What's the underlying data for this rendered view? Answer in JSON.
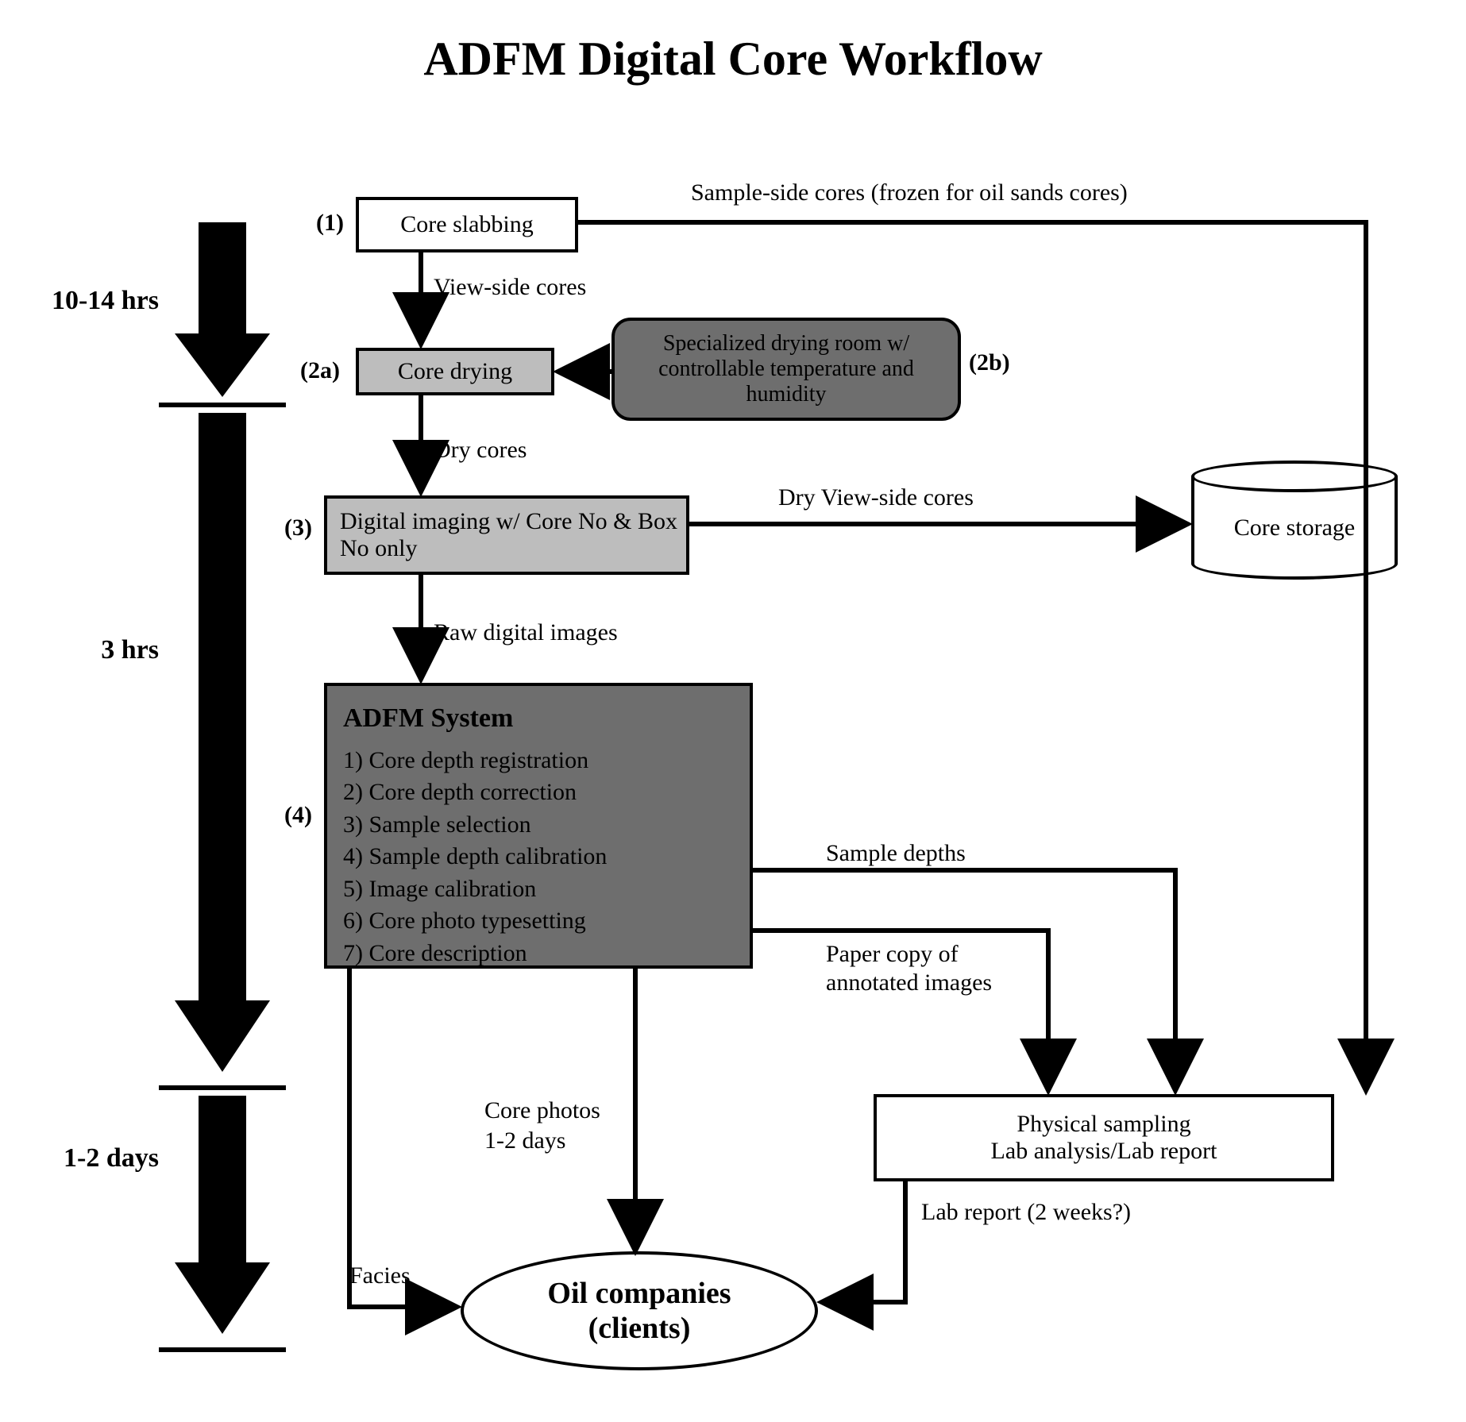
{
  "title": "ADFM Digital Core Workflow",
  "timeline": {
    "t1": "10-14 hrs",
    "t2": "3 hrs",
    "t3": "1-2 days"
  },
  "labels": {
    "n1": "(1)",
    "n2a": "(2a)",
    "n2b": "(2b)",
    "n3": "(3)",
    "n4": "(4)"
  },
  "nodes": {
    "core_slabbing": "Core slabbing",
    "core_drying": "Core drying",
    "drying_room": "Specialized drying room w/ controllable temperature and humidity",
    "digital_imaging": "Digital imaging w/ Core No & Box No only",
    "core_storage": "Core storage",
    "adfm_title": "ADFM System",
    "adfm_1": "1) Core depth registration",
    "adfm_2": "2) Core depth correction",
    "adfm_3": "3) Sample selection",
    "adfm_4": "4) Sample depth calibration",
    "adfm_5": "5) Image calibration",
    "adfm_6": "6) Core photo typesetting",
    "adfm_7": "7) Core description",
    "phys_sampling_l1": "Physical sampling",
    "phys_sampling_l2": "Lab analysis/Lab report",
    "clients_l1": "Oil companies",
    "clients_l2": "(clients)"
  },
  "edges": {
    "sample_side": "Sample-side cores (frozen for oil sands cores)",
    "view_side": "View-side cores",
    "dry_cores": "Dry cores",
    "dry_view_side": "Dry View-side cores",
    "raw_images": "Raw digital images",
    "sample_depths": "Sample depths",
    "paper_copy_l1": "Paper copy of",
    "paper_copy_l2": "annotated images",
    "core_photos_l1": "Core photos",
    "core_photos_l2": "1-2 days",
    "lab_report": "Lab report (2 weeks?)",
    "facies": "Facies"
  }
}
